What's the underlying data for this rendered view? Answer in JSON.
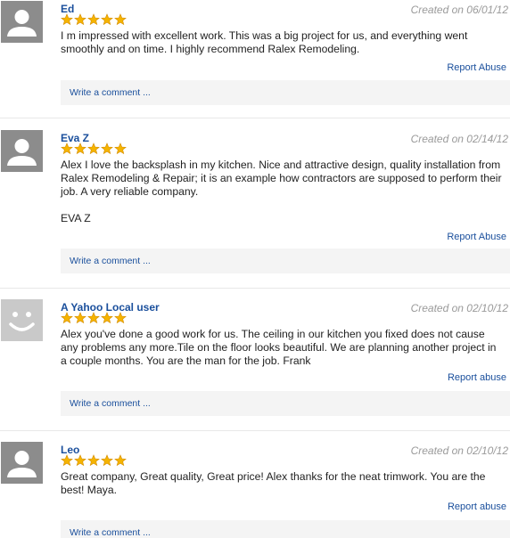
{
  "colors": {
    "link": "#1a4f9c",
    "star": "#f5b400",
    "avatar": "#8c8c8c",
    "comment_bar": "#f4f4f4"
  },
  "reviews": [
    {
      "author": "Ed",
      "created": "Created on 06/01/12",
      "rating": 5,
      "text": "I m impressed with excellent work. This was a big project for us, and everything went smoothly and on time. I highly recommend Ralex Remodeling.",
      "signature": "",
      "report": "Report Abuse",
      "comment": "Write a comment ...",
      "avatar_icon": "person-silhouette-icon"
    },
    {
      "author": "Eva Z",
      "created": "Created on 02/14/12",
      "rating": 5,
      "text": "Alex I love the backsplash in my kitchen. Nice and attractive design, quality installation from Ralex Remodeling & Repair; it is an example how contractors are supposed to perform their job. A very reliable company.",
      "signature": "EVA Z",
      "report": "Report Abuse",
      "comment": "Write a comment ...",
      "avatar_icon": "person-silhouette-icon"
    },
    {
      "author": "A Yahoo Local user",
      "created": "Created on 02/10/12",
      "rating": 5,
      "text": "Alex you've done a good work for us. The ceiling in our kitchen you fixed does not cause any problems any more.Tile on the floor looks beautiful. We are planning another project in a couple months. You are the man for the job. Frank",
      "signature": "",
      "report": "Report abuse",
      "comment": "Write a comment ...",
      "avatar_icon": "smiley-face-icon"
    },
    {
      "author": "Leo",
      "created": "Created on 02/10/12",
      "rating": 5,
      "text": "Great company, Great quality, Great price! Alex thanks for the neat trimwork. You are the best! Maya.",
      "signature": "",
      "report": "Report abuse",
      "comment": "Write a comment ...",
      "avatar_icon": "person-silhouette-icon"
    }
  ]
}
